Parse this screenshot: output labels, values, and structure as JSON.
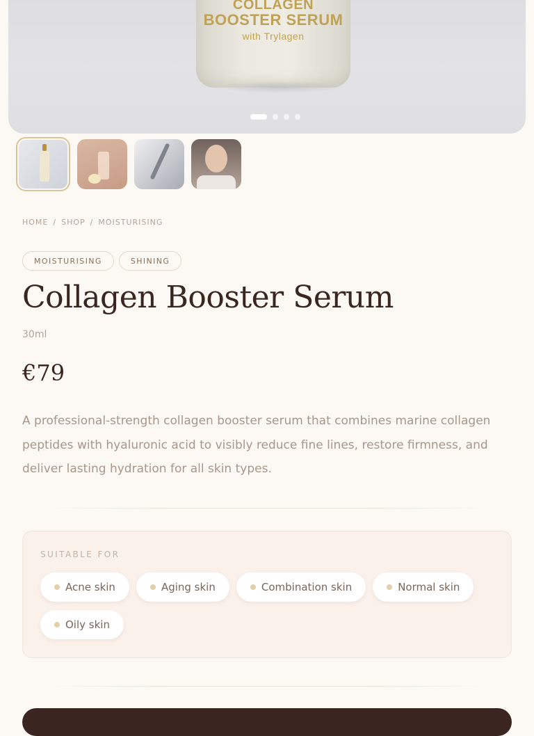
{
  "hero": {
    "bottle_label_lines": [
      "COLLAGEN",
      "BOOSTER SERUM",
      "with Trylagen"
    ],
    "slide_count": 4,
    "active_slide": 1
  },
  "thumbnails": [
    {
      "name": "bottle-front",
      "selected": true
    },
    {
      "name": "bottle-with-flowers",
      "selected": false
    },
    {
      "name": "dropper",
      "selected": false
    },
    {
      "name": "model-applying",
      "selected": false
    }
  ],
  "breadcrumb": [
    "HOME",
    "/",
    "SHOP",
    "/",
    "MOISTURISING"
  ],
  "tags": [
    "MOISTURISING",
    "SHINING"
  ],
  "product": {
    "title": "Collagen Booster Serum",
    "volume": "30ml",
    "price": "€79",
    "description": "A professional-strength collagen booster serum that combines marine collagen peptides with hyaluronic acid to visibly reduce fine lines, restore firmness, and deliver lasting hydration for all skin types."
  },
  "suitable": {
    "label": "SUITABLE FOR",
    "skin_types": [
      "Acne skin",
      "Aging skin",
      "Combination skin",
      "Normal skin",
      "Oily skin"
    ]
  },
  "colors": {
    "background": "#fcf8f3",
    "accent": "#d8c39a",
    "text": "#3a2620",
    "cta": "#3a2520"
  }
}
